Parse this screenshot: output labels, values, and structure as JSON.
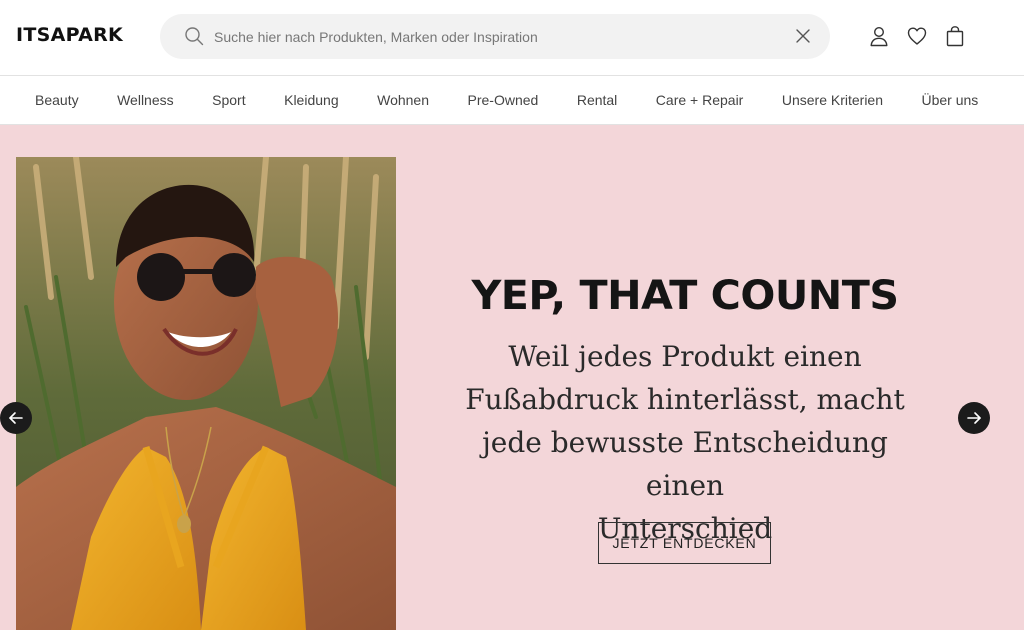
{
  "header": {
    "logo": "ITSAPARK",
    "search_placeholder": "Suche hier nach Produkten, Marken oder Inspiration"
  },
  "nav": {
    "items": [
      "Beauty",
      "Wellness",
      "Sport",
      "Kleidung",
      "Wohnen",
      "Pre-Owned",
      "Rental",
      "Care + Repair",
      "Unsere Kriterien",
      "Über uns"
    ]
  },
  "hero": {
    "headline": "YEP, THAT COUNTS",
    "subline_lines": [
      "Weil jedes Produkt einen",
      "Fußabdruck hinterlässt, macht",
      "jede bewusste Entscheidung einen",
      "Unterschied"
    ],
    "cta": "JETZT ENTDECKEN",
    "background_color": "#f3d6d9"
  },
  "icons": [
    "search-icon",
    "close-icon",
    "account-icon",
    "wishlist-heart-icon",
    "shopping-bag-icon",
    "arrow-left-icon",
    "arrow-right-icon"
  ]
}
